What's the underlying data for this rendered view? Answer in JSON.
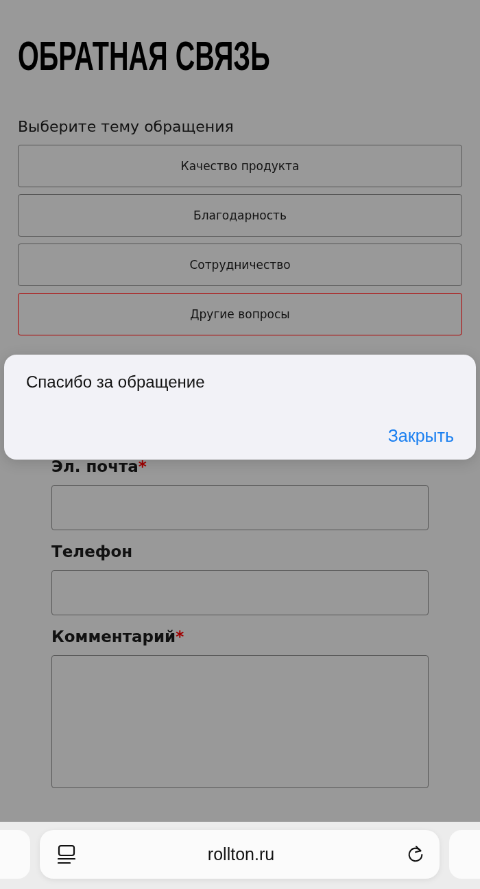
{
  "page": {
    "title": "ОБРАТНАЯ СВЯЗЬ",
    "topic_prompt": "Выберите тему обращения",
    "topics": [
      {
        "label": "Качество продукта",
        "selected": false
      },
      {
        "label": "Благодарность",
        "selected": false
      },
      {
        "label": "Сотрудничество",
        "selected": false
      },
      {
        "label": "Другие вопросы",
        "selected": true
      }
    ]
  },
  "form": {
    "fields": [
      {
        "label": "Эл. почта",
        "required_mark": "*",
        "kind": "input"
      },
      {
        "label": "Телефон",
        "kind": "input"
      },
      {
        "label": "Комментарий",
        "required_mark": "*",
        "kind": "textarea"
      }
    ]
  },
  "alert": {
    "message": "Спасибо за обращение",
    "button": "Закрыть"
  },
  "browser_bar": {
    "url": "rollton.ru"
  }
}
